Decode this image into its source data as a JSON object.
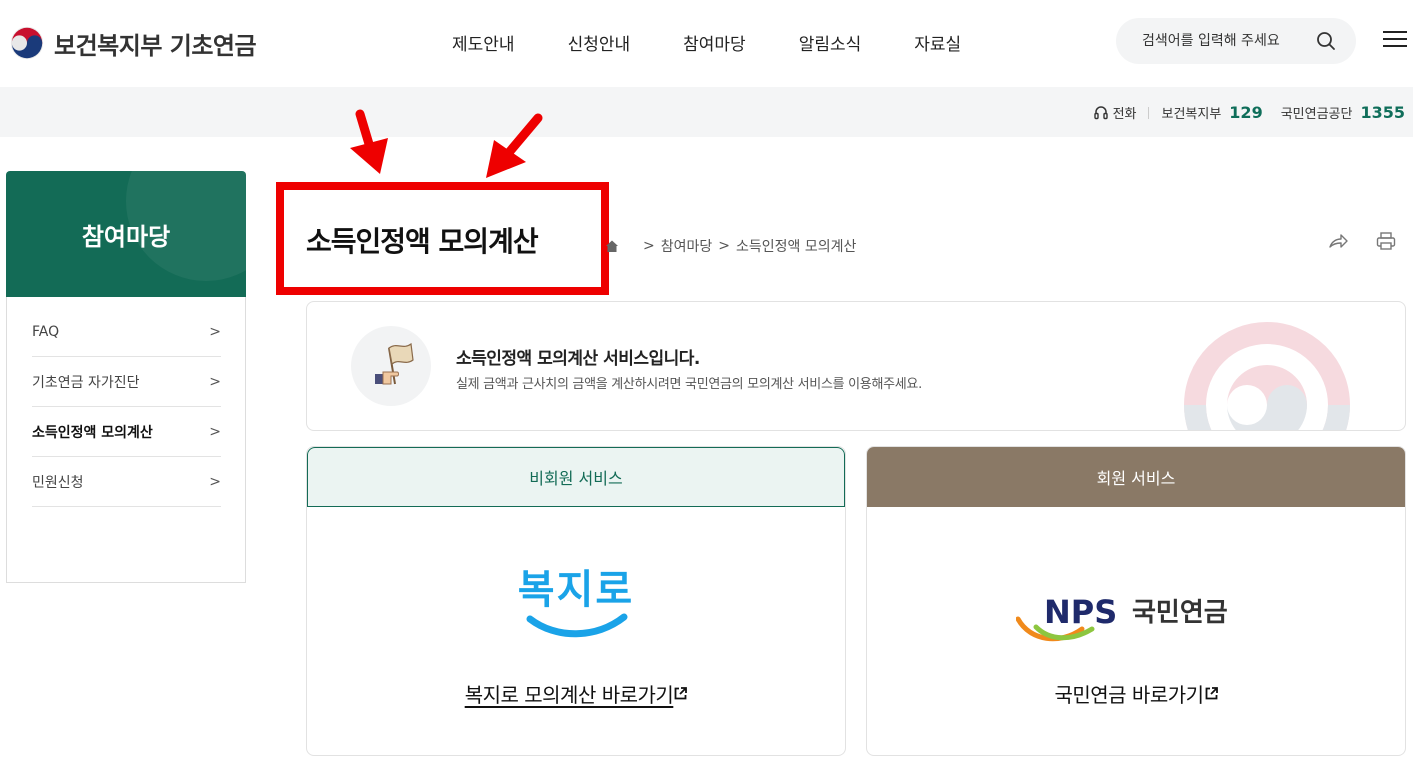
{
  "header": {
    "logo_text": "보건복지부 기초연금",
    "nav": [
      "제도안내",
      "신청안내",
      "참여마당",
      "알림소식",
      "자료실"
    ],
    "search_placeholder": "검색어를 입력해 주세요"
  },
  "util_bar": {
    "phone_label": "전화",
    "org1_label": "보건복지부",
    "org1_number": "129",
    "org2_label": "국민연금공단",
    "org2_number": "1355"
  },
  "sidebar": {
    "title": "참여마당",
    "items": [
      {
        "label": "FAQ",
        "active": false
      },
      {
        "label": "기초연금 자가진단",
        "active": false
      },
      {
        "label": "소득인정액 모의계산",
        "active": true
      },
      {
        "label": "민원신청",
        "active": false
      }
    ]
  },
  "page": {
    "title": "소득인정액 모의계산",
    "breadcrumb": [
      "참여마당",
      "소득인정액 모의계산"
    ]
  },
  "info": {
    "title": "소득인정액 모의계산 서비스입니다.",
    "desc": "실제 금액과 근사치의 금액을 계산하시려면 국민연금의 모의계산 서비스를 이용해주세요."
  },
  "cards": [
    {
      "header": "비회원 서비스",
      "logo_text": "복지로",
      "link": "복지로 모의계산 바로가기"
    },
    {
      "header": "회원 서비스",
      "logo_text_brand": "NPS",
      "logo_text_name": "국민연금",
      "link": "국민연금 바로가기"
    }
  ],
  "colors": {
    "brand_green": "#136b56",
    "member_brown": "#8a7966",
    "highlight_red": "#ee0000",
    "bokjiro_blue": "#1aa3e8"
  },
  "icons": {
    "search": "search-icon",
    "menu": "hamburger-menu-icon",
    "phone": "headset-icon",
    "home": "home-icon",
    "share": "share-icon",
    "print": "print-icon",
    "external": "external-link-icon"
  }
}
